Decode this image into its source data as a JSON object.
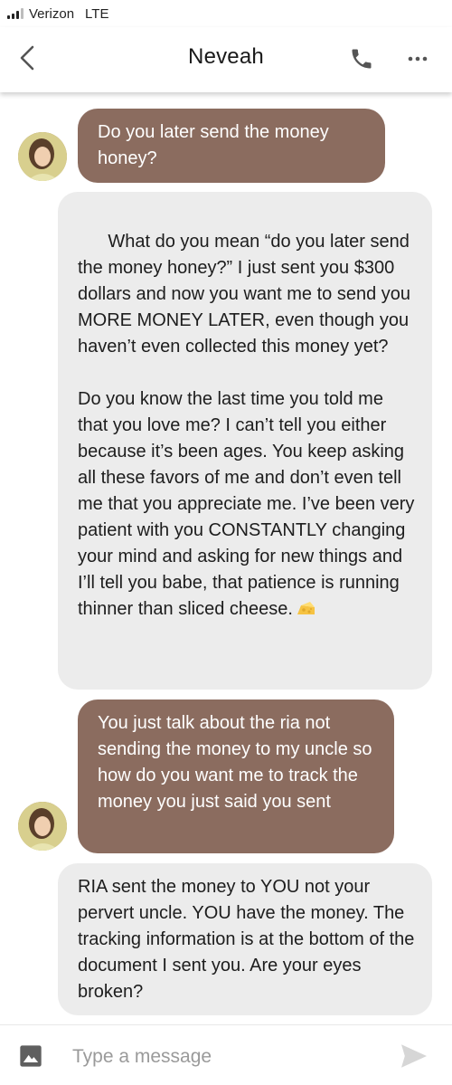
{
  "status_bar": {
    "carrier": "Verizon",
    "network": "LTE"
  },
  "header": {
    "contact_name": "Neveah",
    "back_icon": "chevron-left-icon",
    "call_icon": "phone-icon",
    "more_icon": "more-horizontal-icon"
  },
  "messages": [
    {
      "direction": "incoming",
      "text": "Do you later send the money honey?"
    },
    {
      "direction": "outgoing",
      "text_line1": "What do you mean “do you later send the money honey?” I just sent you $300 dollars and now you want me to send you MORE MONEY LATER, even though you haven’t even collected this money yet?",
      "text_line2": "Do you know the last time you told me that you love me? I can’t tell you either because it’s been ages. You keep asking all these favors of me and don’t even tell me that you appreciate me. I’ve been very patient with you CONSTANTLY changing your mind and asking for new things and I’ll tell you babe, that patience is running thinner than sliced cheese.",
      "emoji": "cheese-emoji"
    },
    {
      "direction": "incoming",
      "text": "You just talk about the ria not sending the money to my uncle so how do you want me to track the money you just said you sent"
    },
    {
      "direction": "outgoing",
      "text": "RIA sent the money to YOU not your pervert uncle. YOU have the money. The tracking information is at the bottom of the document I sent you. Are your eyes broken?"
    }
  ],
  "composer": {
    "placeholder": "Type a message",
    "image_icon": "image-icon",
    "send_icon": "send-icon"
  },
  "colors": {
    "incoming_bubble": "#8b6c5f",
    "outgoing_bubble": "#ececec",
    "send_icon": "#d6d6d6"
  }
}
